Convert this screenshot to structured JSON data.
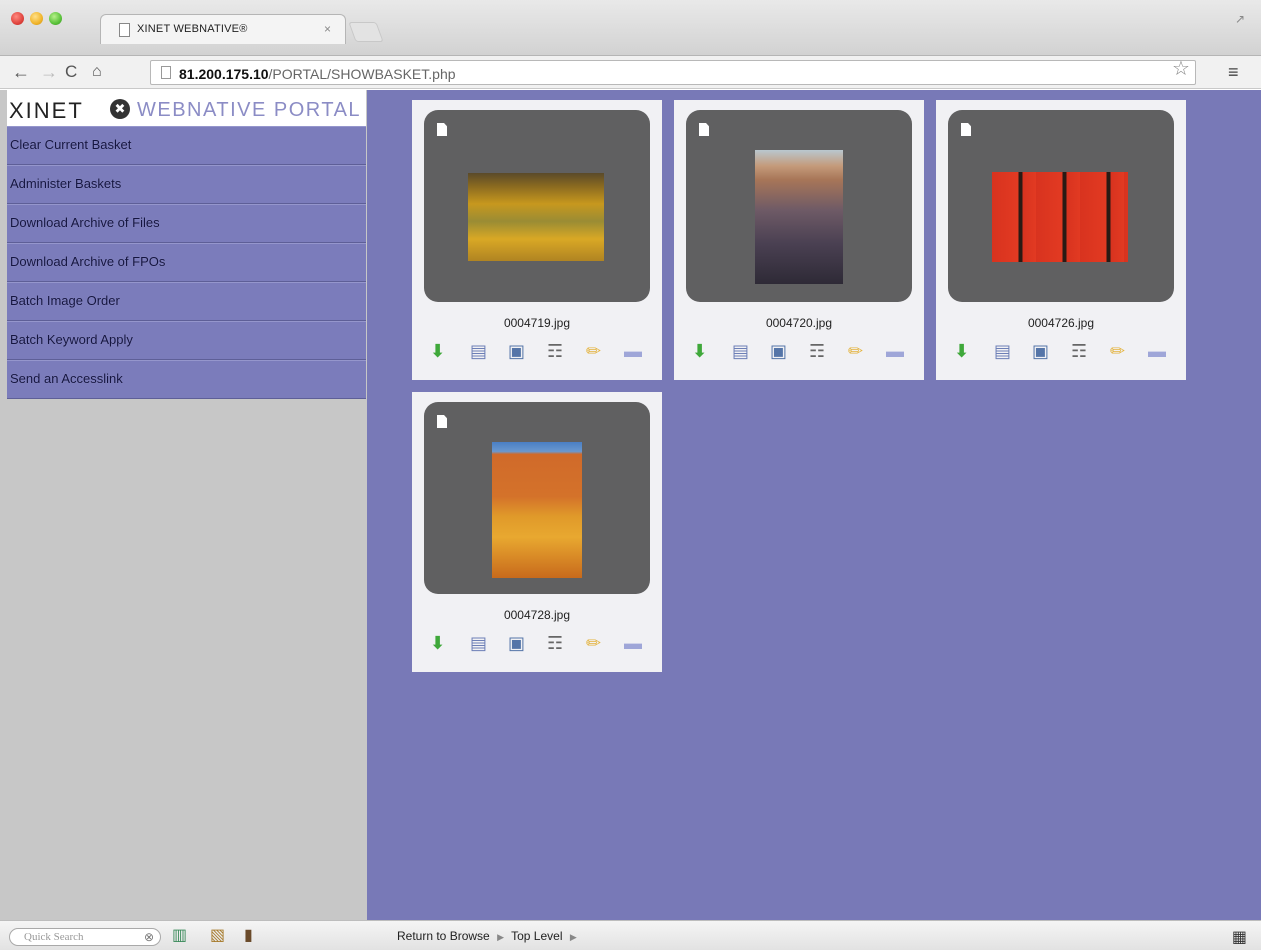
{
  "browser": {
    "tab_title": "XINET WEBNATIVE®",
    "tab_close": "×",
    "url_host": "81.200.175.10",
    "url_path": "/PORTAL/SHOWBASKET.php",
    "icons": {
      "back": "←",
      "forward": "→",
      "reload": "C",
      "home": "⌂",
      "star": "☆",
      "menu": "≡"
    }
  },
  "logo": {
    "xinet": "XINET",
    "badge": "✖",
    "portal": "WEBNATIVE PORTAL"
  },
  "sidebar": {
    "items": [
      {
        "label": "Clear Current Basket"
      },
      {
        "label": "Administer Baskets"
      },
      {
        "label": "Download Archive of Files"
      },
      {
        "label": "Download Archive of FPOs"
      },
      {
        "label": "Batch Image Order"
      },
      {
        "label": "Batch Keyword Apply"
      },
      {
        "label": "Send an Accesslink"
      }
    ]
  },
  "cards": [
    {
      "filename": "0004719.jpg"
    },
    {
      "filename": "0004720.jpg"
    },
    {
      "filename": "0004726.jpg"
    },
    {
      "filename": "0004728.jpg"
    }
  ],
  "action_icons": {
    "download": "⬇",
    "move": "▤",
    "preview": "▣",
    "cart": "☶",
    "edit": "✏",
    "folder": "▬"
  },
  "bottombar": {
    "search_placeholder": "Quick Search",
    "search_clear": "⊗",
    "basket_icon": "▥",
    "lightbox_icon": "▧",
    "logout_icon": "▮",
    "return_to_browse": "Return to Browse",
    "top_level": "Top Level",
    "crumb_arrow": "▶",
    "grid_icon": "▦"
  },
  "colors": {
    "content_bg": "#7879b7",
    "sidebar_bg": "#c7c7c7",
    "menu_item_bg": "#7b7cbb",
    "card_bg": "#f1f1f4",
    "thumb_bg": "#606061",
    "logo_portal": "#8b8cc5"
  }
}
